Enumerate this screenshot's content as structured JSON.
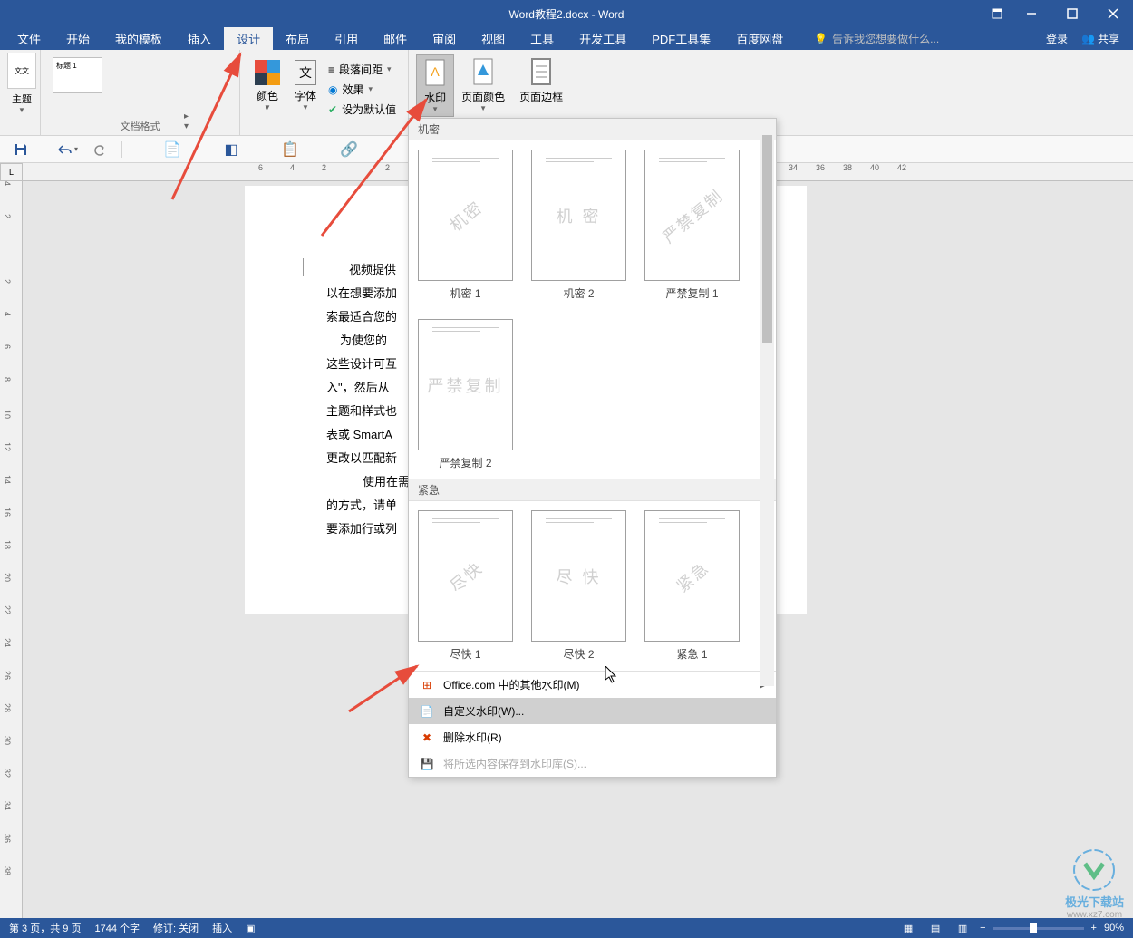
{
  "title": "Word教程2.docx - Word",
  "menubar": {
    "file": "文件",
    "home": "开始",
    "templates": "我的模板",
    "insert": "插入",
    "design": "设计",
    "layout": "布局",
    "references": "引用",
    "mailings": "邮件",
    "review": "审阅",
    "view": "视图",
    "tools": "工具",
    "developer": "开发工具",
    "pdf": "PDF工具集",
    "baidu": "百度网盘",
    "tellme": "告诉我您想要做什么...",
    "login": "登录",
    "share": "共享"
  },
  "ribbon": {
    "theme_label": "主题",
    "theme_icon": "文文",
    "style_thumb": "标题 1",
    "group_doc_format": "文档格式",
    "colors": "颜色",
    "fonts": "字体",
    "paragraph_spacing": "段落间距",
    "effects": "效果",
    "set_default": "设为默认值",
    "watermark": "水印",
    "page_color": "页面颜色",
    "page_border": "页面边框"
  },
  "watermark_dropdown": {
    "section_confidential": "机密",
    "section_urgent": "紧急",
    "items": [
      {
        "text": "机密",
        "label": "机密 1",
        "diag": true
      },
      {
        "text": "机 密",
        "label": "机密 2",
        "diag": false
      },
      {
        "text": "严禁复制",
        "label": "严禁复制 1",
        "diag": true
      },
      {
        "text": "严禁复制",
        "label": "严禁复制 2",
        "diag": false
      },
      {
        "text": "尽快",
        "label": "尽快 1",
        "diag": true
      },
      {
        "text": "尽 快",
        "label": "尽快 2",
        "diag": false
      },
      {
        "text": "紧急",
        "label": "紧急 1",
        "diag": true
      }
    ],
    "office_more": "Office.com 中的其他水印(M)",
    "custom": "自定义水印(W)...",
    "remove": "删除水印(R)",
    "save_selection": "将所选内容保存到水印库(S)..."
  },
  "document": {
    "lines": [
      "视频提供",
      "以在想要添加",
      "索最适合您的",
      "为使您的",
      "这些设计可互",
      "入\"，然后从",
      "主题和样式也",
      "表或 SmartA",
      "更改以匹配新",
      "使用在需",
      "的方式，请单",
      "要添加行或列"
    ]
  },
  "ruler_h": [
    "6",
    "4",
    "2",
    "",
    "2",
    "",
    "",
    "",
    "",
    "",
    "",
    "",
    "",
    "",
    "",
    "",
    "",
    "",
    "",
    "",
    "",
    "34",
    "36",
    "38",
    "40",
    "42"
  ],
  "ruler_v": [
    "4",
    "2",
    "",
    "2",
    "4",
    "6",
    "8",
    "10",
    "12",
    "14",
    "16",
    "18",
    "20",
    "22",
    "24",
    "26",
    "28",
    "30",
    "32",
    "34",
    "36",
    "38"
  ],
  "statusbar": {
    "page": "第 3 页，共 9 页",
    "words": "1744 个字",
    "revision": "修订: 关闭",
    "insert": "插入",
    "zoom": "90%"
  },
  "logo": {
    "text": "极光下载站",
    "url": "www.xz7.com"
  }
}
